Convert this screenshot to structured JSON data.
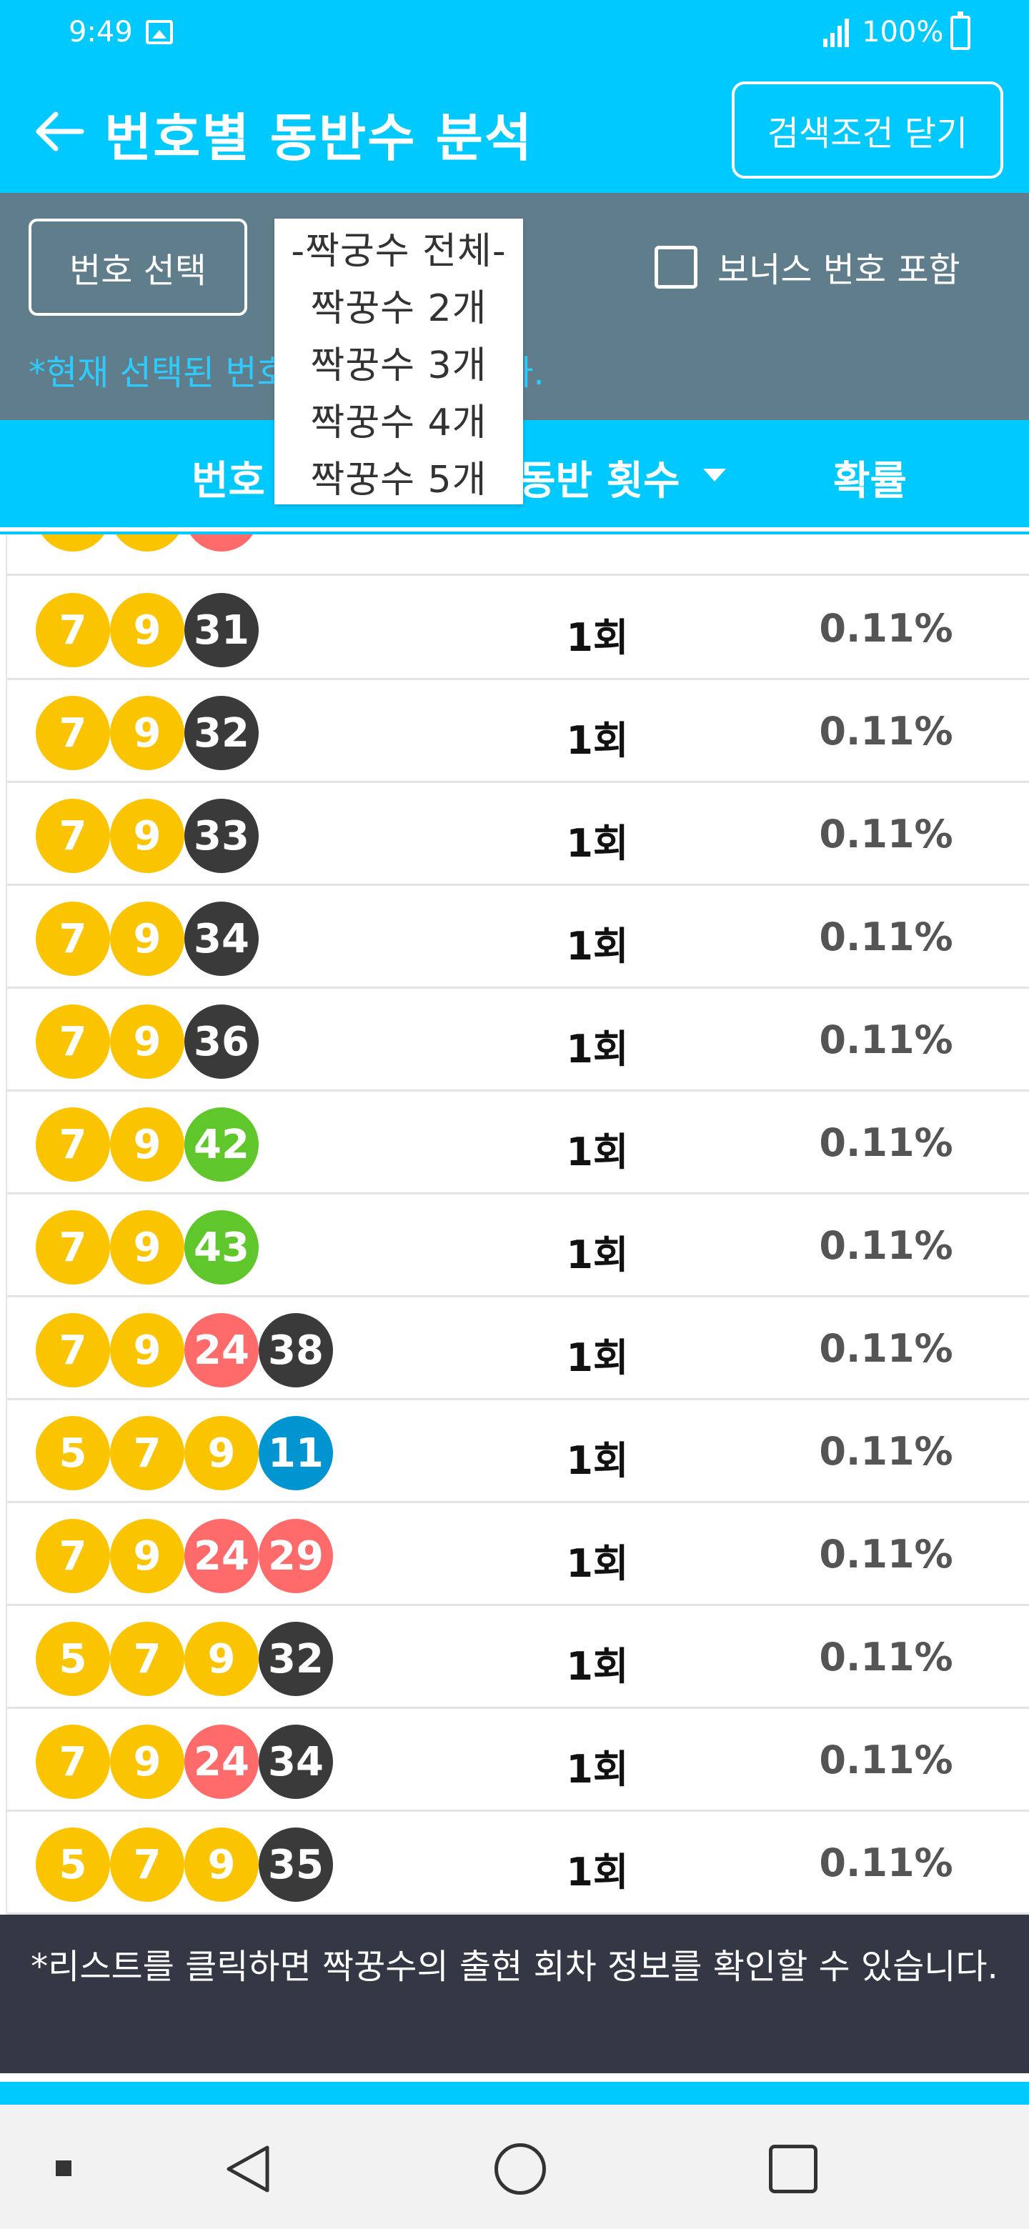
{
  "status": {
    "time": "9:49",
    "battery": "100%"
  },
  "header": {
    "title": "번호별 동반수 분석",
    "close_search_label": "검색조건 닫기"
  },
  "filters": {
    "select_number_label": "번호 선택",
    "bonus_label": "보너스 번호 포함",
    "bonus_checked": false,
    "selected_note": "*현재 선택된 번호는 7, 9번 입니다."
  },
  "dropdown": {
    "options": [
      "-짝궁수 전체-",
      "짝꿍수 2개",
      "짝꿍수 3개",
      "짝꿍수 4개",
      "짝꿍수 5개"
    ]
  },
  "table": {
    "headers": {
      "number": "번호",
      "count": "동반 횟수",
      "probability": "확률"
    },
    "rows": [
      {
        "balls": [
          7,
          9,
          31
        ],
        "count": "1회",
        "prob": "0.11%"
      },
      {
        "balls": [
          7,
          9,
          32
        ],
        "count": "1회",
        "prob": "0.11%"
      },
      {
        "balls": [
          7,
          9,
          33
        ],
        "count": "1회",
        "prob": "0.11%"
      },
      {
        "balls": [
          7,
          9,
          34
        ],
        "count": "1회",
        "prob": "0.11%"
      },
      {
        "balls": [
          7,
          9,
          36
        ],
        "count": "1회",
        "prob": "0.11%"
      },
      {
        "balls": [
          7,
          9,
          42
        ],
        "count": "1회",
        "prob": "0.11%"
      },
      {
        "balls": [
          7,
          9,
          43
        ],
        "count": "1회",
        "prob": "0.11%"
      },
      {
        "balls": [
          7,
          9,
          24,
          38
        ],
        "count": "1회",
        "prob": "0.11%"
      },
      {
        "balls": [
          5,
          7,
          9,
          11
        ],
        "count": "1회",
        "prob": "0.11%"
      },
      {
        "balls": [
          7,
          9,
          24,
          29
        ],
        "count": "1회",
        "prob": "0.11%"
      },
      {
        "balls": [
          5,
          7,
          9,
          32
        ],
        "count": "1회",
        "prob": "0.11%"
      },
      {
        "balls": [
          7,
          9,
          24,
          34
        ],
        "count": "1회",
        "prob": "0.11%"
      },
      {
        "balls": [
          5,
          7,
          9,
          35
        ],
        "count": "1회",
        "prob": "0.11%"
      }
    ]
  },
  "ball_colors": {
    "1-10": "#fbc400",
    "11-20": "#0095d0",
    "21-30": "#ff6b6b",
    "31-40": "#3a3a3a",
    "41-45": "#5fc72c"
  },
  "info": {
    "text": "*리스트를 클릭하면 짝꿍수의 출현 회차 정보를 확인할 수 있습니다."
  }
}
